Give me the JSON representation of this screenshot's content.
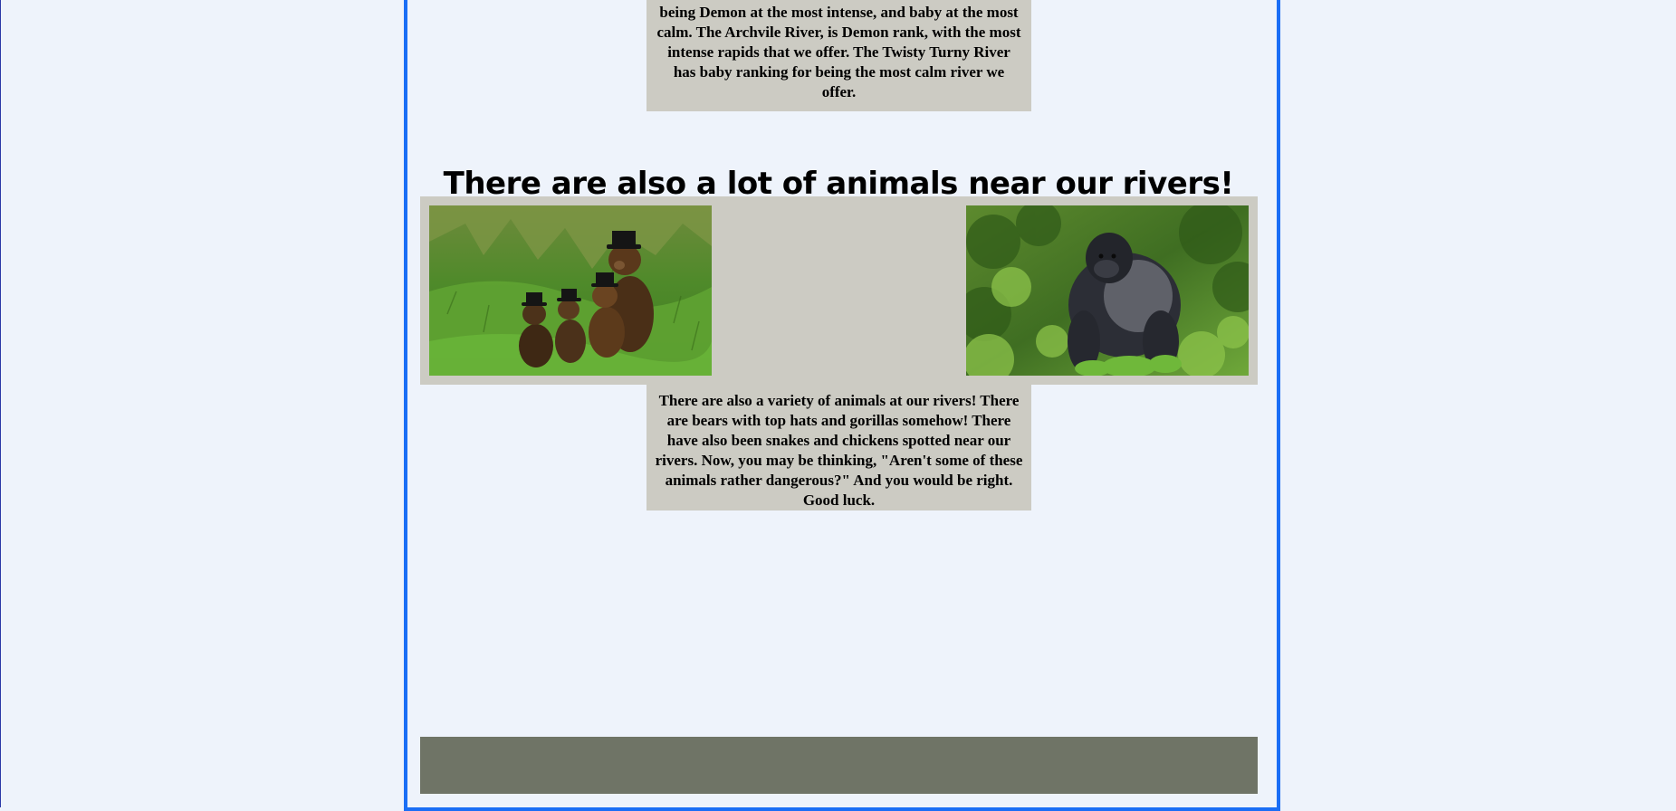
{
  "rivers": {
    "description": "being Demon at the most intense, and baby at the most calm. The Archvile River, is Demon rank, with the most intense rapids that we offer. The Twisty Turny River has baby ranking for being the most calm river we offer."
  },
  "animals": {
    "heading": "There are also a lot of animals near our rivers!",
    "description": "There are also a variety of animals at our rivers! There are bears with top hats and gorillas somehow! There have also been snakes and chickens spotted near our rivers. Now, you may be thinking, \"Aren't some of these animals rather dangerous?\" And you would be right. Good luck.",
    "images": [
      {
        "icon": "bears-in-top-hats-photo"
      },
      {
        "icon": "gorilla-photo"
      }
    ]
  },
  "colors": {
    "page_background": "#eef3fb",
    "frame_border": "#1a6ef5",
    "text_box": "#cccbc3",
    "footer": "#6f7466"
  }
}
